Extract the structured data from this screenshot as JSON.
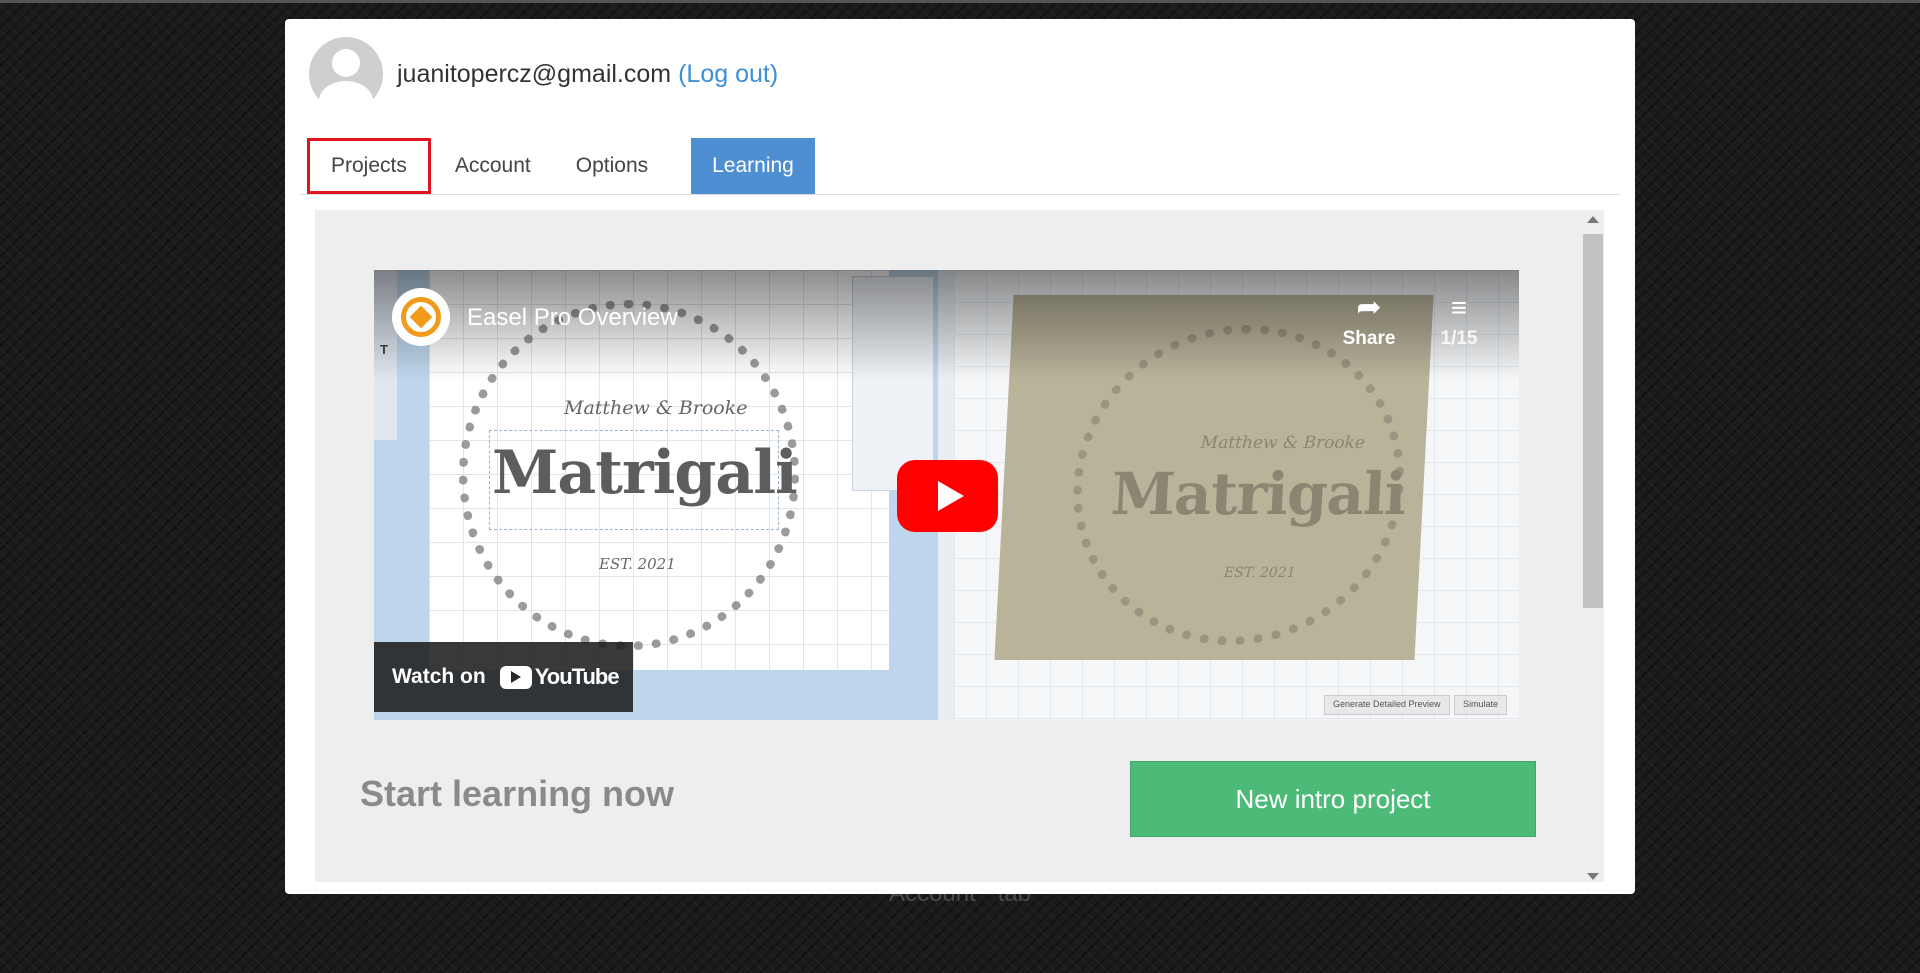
{
  "user": {
    "email": "juanitopercz@gmail.com",
    "logout_label": "(Log out)"
  },
  "tabs": [
    {
      "label": "Projects",
      "active": false,
      "highlighted": true
    },
    {
      "label": "Account",
      "active": false
    },
    {
      "label": "Options",
      "active": false
    },
    {
      "label": "Learning",
      "active": true
    }
  ],
  "video": {
    "title": "Easel Pro Overview",
    "share_label": "Share",
    "playlist_position": "1/15",
    "watch_on_label": "Watch on",
    "youtube_label": "YouTube",
    "thumbnail": {
      "heading": "Matrigali",
      "subtitle": "Matthew & Brooke",
      "established": "EST. 2021",
      "preview_button": "Generate Detailed Preview",
      "simulate_button": "Simulate"
    }
  },
  "learning": {
    "heading": "Start learning now",
    "cta_label": "New intro project"
  },
  "background": {
    "caption": "Account \" tab"
  },
  "colors": {
    "learning_tab": "#4d8fd2",
    "cta_button": "#4dbb78",
    "highlight_border": "#e0141e",
    "link": "#3d8fd6",
    "youtube_red": "#ff0000"
  }
}
